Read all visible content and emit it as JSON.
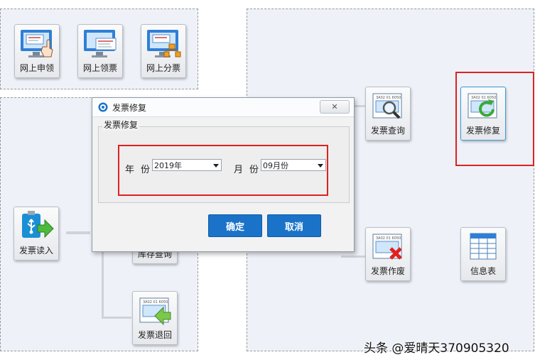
{
  "tiles": {
    "online_apply": "网上申领",
    "online_collect": "网上领票",
    "online_distribute": "网上分票",
    "invoice_read": "发票读入",
    "inventory_query": "库存查询",
    "invoice_return": "发票退回",
    "invoice_query": "发票查询",
    "invoice_repair": "发票修复",
    "invoice_void": "发票作废",
    "info_table": "信息表"
  },
  "dialog": {
    "title": "发票修复",
    "close_label": "✕",
    "group_label": "发票修复",
    "year_label": "年份",
    "year_value": "2019年",
    "month_label": "月份",
    "month_value": "09月份",
    "ok_label": "确定",
    "cancel_label": "取消"
  },
  "colors": {
    "accent": "#1a73c8",
    "highlight": "#e02020",
    "panel": "#eef2f8"
  },
  "watermark": "头条 @爱晴天370905320"
}
